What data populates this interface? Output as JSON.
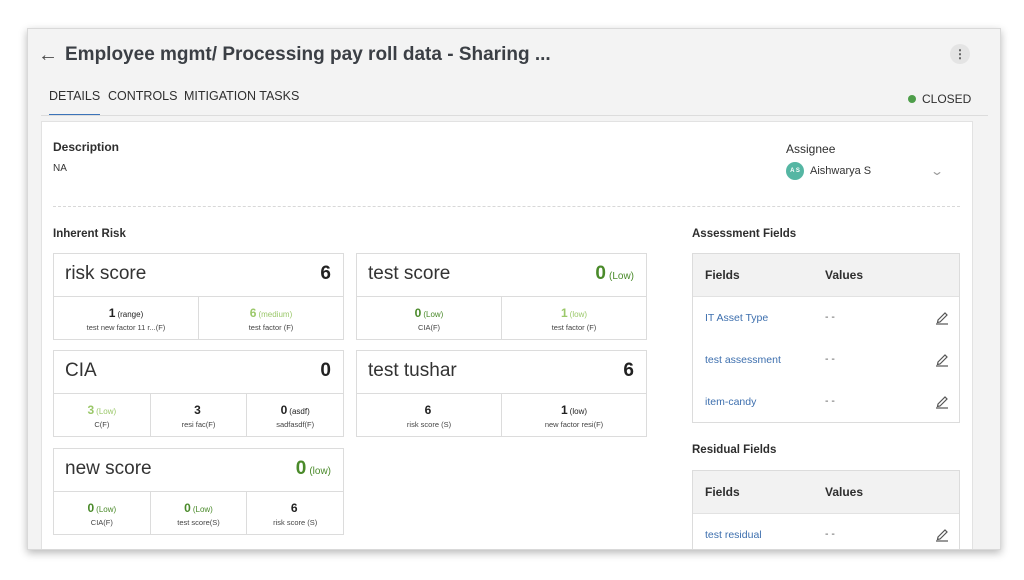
{
  "header": {
    "title": "Employee mgmt/ Processing pay roll data - Sharing ...",
    "back_icon": "arrow-left-icon",
    "more_icon": "kebab-menu-icon",
    "more_glyph": "⋮"
  },
  "tabs": [
    {
      "label": "DETAILS",
      "active": true
    },
    {
      "label": "CONTROLS",
      "active": false
    },
    {
      "label": "MITIGATION TASKS",
      "active": false
    }
  ],
  "status": {
    "label": "CLOSED",
    "color": "#4e9e4a"
  },
  "description": {
    "label": "Description",
    "value": "NA"
  },
  "assignee": {
    "label": "Assignee",
    "initials": "A S",
    "name": "Aishwarya S",
    "avatar_color": "#55b6a3"
  },
  "inherent_risk": {
    "label": "Inherent Risk",
    "cards": [
      {
        "name": "risk score",
        "score": "6",
        "qualifier": "",
        "factors": [
          {
            "value": "1",
            "qualifier": "(range)",
            "name": "test new factor 11 r...(F)",
            "tone": "default"
          },
          {
            "value": "6",
            "qualifier": "(medium)",
            "name": "test factor (F)",
            "tone": "light-green"
          }
        ]
      },
      {
        "name": "test score",
        "score": "0",
        "qualifier": "(Low)",
        "tone": "dark-green",
        "factors": [
          {
            "value": "0",
            "qualifier": "(Low)",
            "name": "CIA(F)",
            "tone": "dark-green"
          },
          {
            "value": "1",
            "qualifier": "(low)",
            "name": "test factor (F)",
            "tone": "light-green"
          }
        ]
      },
      {
        "name": "CIA",
        "score": "0",
        "qualifier": "",
        "factors": [
          {
            "value": "3",
            "qualifier": "(Low)",
            "name": "C(F)",
            "tone": "light-green"
          },
          {
            "value": "3",
            "qualifier": "",
            "name": "resi fac(F)",
            "tone": "default"
          },
          {
            "value": "0",
            "qualifier": "(asdf)",
            "name": "sadfasdf(F)",
            "tone": "default"
          }
        ]
      },
      {
        "name": "test tushar",
        "score": "6",
        "qualifier": "",
        "factors": [
          {
            "value": "6",
            "qualifier": "",
            "name": "risk score (S)",
            "tone": "default"
          },
          {
            "value": "1",
            "qualifier": "(low)",
            "name": "new factor resi(F)",
            "tone": "default"
          }
        ]
      },
      {
        "name": "new score",
        "score": "0",
        "qualifier": "(low)",
        "tone": "dark-green",
        "factors": [
          {
            "value": "0",
            "qualifier": "(Low)",
            "name": "CIA(F)",
            "tone": "dark-green"
          },
          {
            "value": "0",
            "qualifier": "(Low)",
            "name": "test score(S)",
            "tone": "dark-green"
          },
          {
            "value": "6",
            "qualifier": "",
            "name": "risk score (S)",
            "tone": "default"
          }
        ]
      }
    ]
  },
  "assessment_fields": {
    "label": "Assessment Fields",
    "col_fields": "Fields",
    "col_values": "Values",
    "rows": [
      {
        "field": "IT Asset Type",
        "value": "- -"
      },
      {
        "field": "test assessment",
        "value": "- -"
      },
      {
        "field": "item-candy",
        "value": "- -"
      }
    ]
  },
  "residual_fields": {
    "label": "Residual Fields",
    "col_fields": "Fields",
    "col_values": "Values",
    "rows": [
      {
        "field": "test residual",
        "value": "- -"
      }
    ]
  },
  "colors": {
    "accent": "#3b73b9",
    "link": "#3d6fae",
    "green_dark": "#4a8a2a",
    "green_light": "#9bc86a"
  }
}
